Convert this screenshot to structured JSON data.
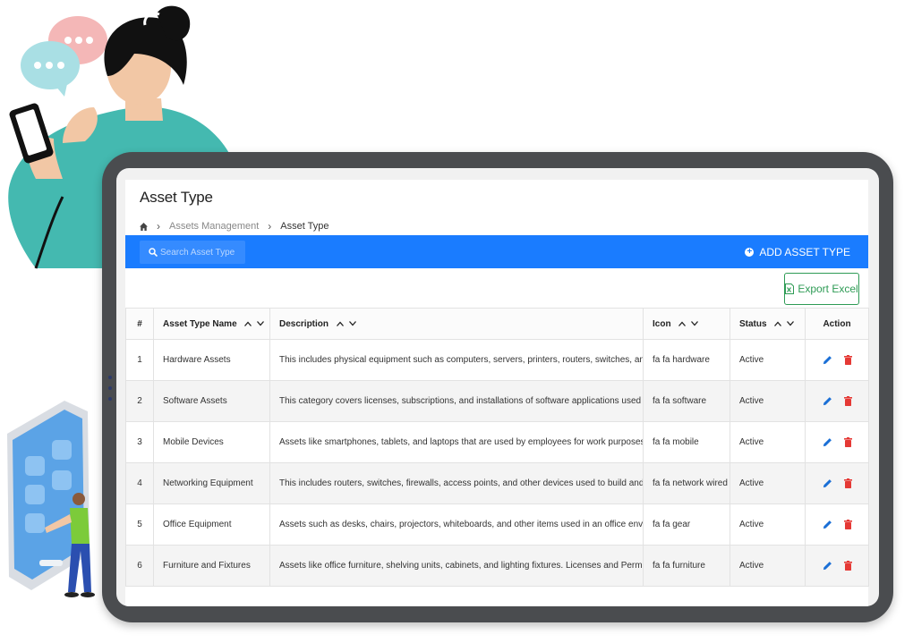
{
  "page": {
    "title": "Asset Type",
    "breadcrumb": {
      "parent": "Assets Management",
      "current": "Asset Type"
    }
  },
  "toolbar": {
    "search_placeholder": "Search Asset Type",
    "add_label": "ADD ASSET TYPE",
    "export_label": "Export Excel"
  },
  "table": {
    "headers": {
      "num": "#",
      "name": "Asset Type Name",
      "description": "Description",
      "icon": "Icon",
      "status": "Status",
      "action": "Action"
    },
    "rows": [
      {
        "num": "1",
        "name": "Hardware Assets",
        "description": "This includes physical equipment such as computers, servers, printers, routers, switches, and other",
        "icon": "fa fa hardware",
        "status": "Active"
      },
      {
        "num": "2",
        "name": "Software Assets",
        "description": "This category covers licenses, subscriptions, and installations of software applications used within",
        "icon": "fa fa software",
        "status": "Active"
      },
      {
        "num": "3",
        "name": "Mobile Devices",
        "description": "Assets like smartphones, tablets, and laptops that are used by employees for work purposes.",
        "icon": "fa fa mobile",
        "status": "Active"
      },
      {
        "num": "4",
        "name": "Networking Equipment",
        "description": "This includes routers, switches, firewalls, access points, and other devices used to build and main",
        "icon": "fa fa network wired",
        "status": "Active"
      },
      {
        "num": "5",
        "name": "Office Equipment",
        "description": "Assets such as desks, chairs, projectors, whiteboards, and other items used in an office environment",
        "icon": "fa fa gear",
        "status": "Active"
      },
      {
        "num": "6",
        "name": "Furniture and Fixtures",
        "description": "Assets like office furniture, shelving units, cabinets, and lighting fixtures. Licenses and Permits",
        "icon": "fa fa furniture",
        "status": "Active"
      }
    ]
  },
  "icons": {
    "home": "home-icon",
    "search": "search-icon",
    "add": "plus-circle-icon",
    "export": "excel-icon",
    "edit": "pencil-icon",
    "delete": "trash-icon"
  },
  "colors": {
    "primary": "#1a7cff",
    "export": "#2e9b55",
    "edit": "#1a6fd6",
    "delete": "#e53935"
  }
}
